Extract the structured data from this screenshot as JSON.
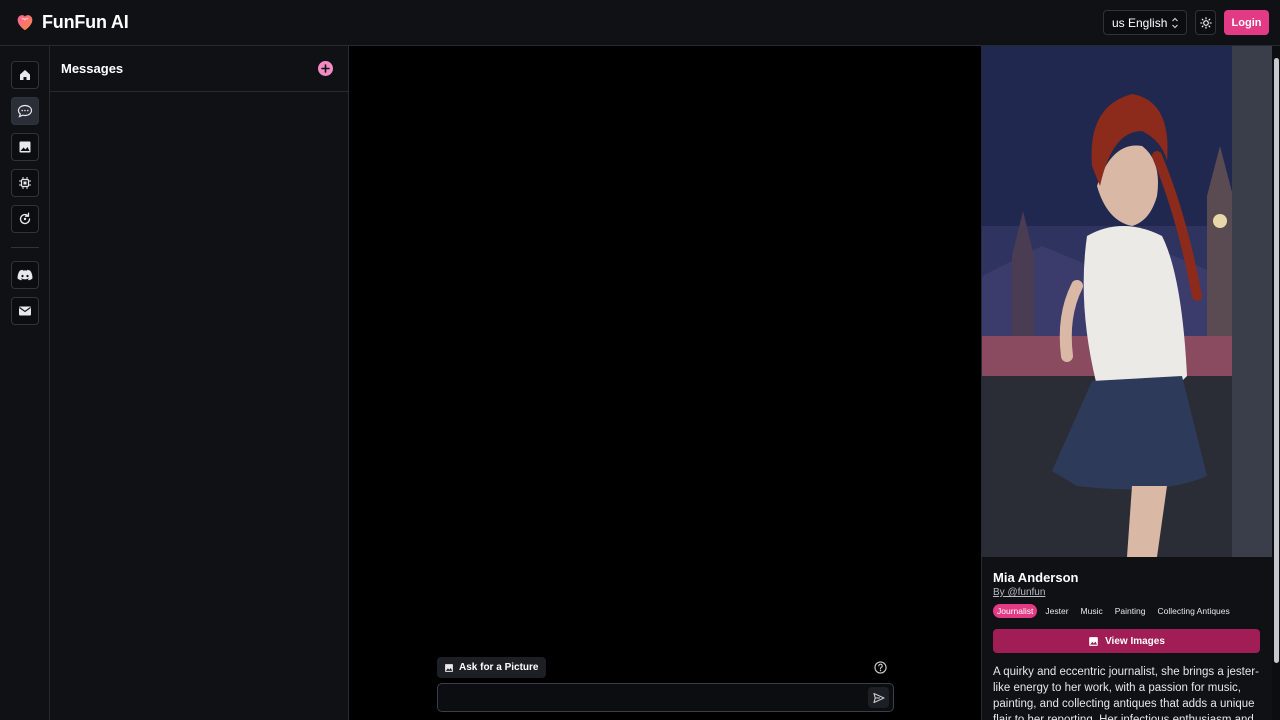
{
  "header": {
    "app_name": "FunFun AI",
    "language_label": "us English",
    "login_label": "Login"
  },
  "sidebar": {
    "items": [
      {
        "name": "home",
        "icon": "home-icon"
      },
      {
        "name": "chat",
        "icon": "chat-bubble-icon",
        "active": true
      },
      {
        "name": "images",
        "icon": "image-icon"
      },
      {
        "name": "settings",
        "icon": "chip-icon"
      },
      {
        "name": "refresh",
        "icon": "refresh-icon"
      },
      {
        "name": "discord",
        "icon": "discord-icon"
      },
      {
        "name": "mail",
        "icon": "mail-icon"
      }
    ]
  },
  "messages": {
    "title": "Messages"
  },
  "chat": {
    "ask_picture_label": "Ask for a Picture",
    "input_value": "",
    "input_placeholder": ""
  },
  "profile": {
    "name": "Mia Anderson",
    "author": "By @funfun",
    "tags": [
      "Journalist",
      "Jester",
      "Music",
      "Painting",
      "Collecting Antiques"
    ],
    "view_images_label": "View Images",
    "bio": "A quirky and eccentric journalist, she brings a jester-like energy to her work, with a passion for music, painting, and collecting antiques that adds a unique flair to her reporting. Her infectious enthusiasm and ability"
  },
  "colors": {
    "accent": "#e33a86",
    "accent_dark": "#a01e55",
    "panel": "#0f1115",
    "border": "#262a31"
  }
}
